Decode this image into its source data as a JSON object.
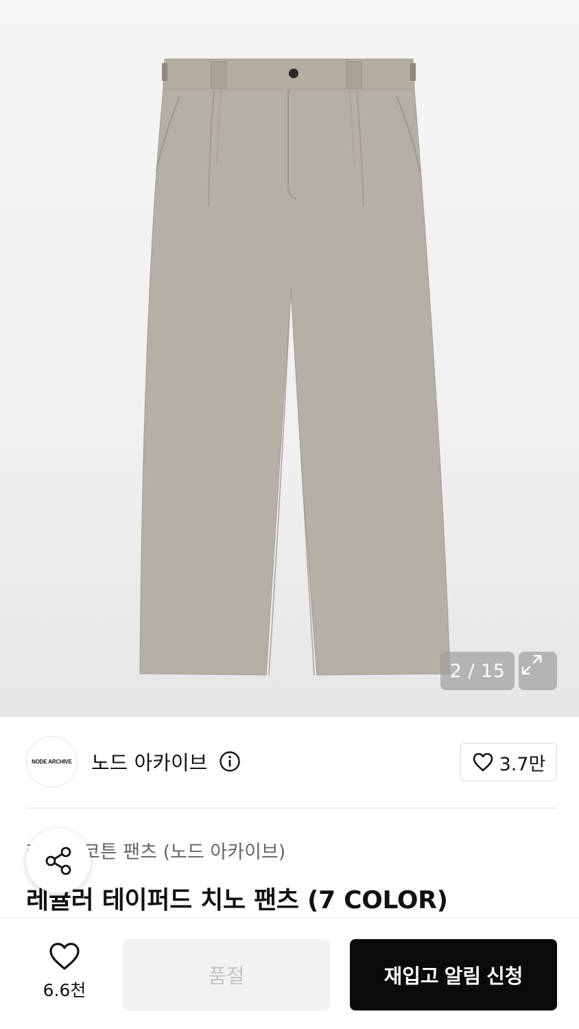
{
  "gallery": {
    "counter": "2 / 15",
    "product_image_alt": "beige chino pants"
  },
  "brand": {
    "logo_text": "NODE ARCHIVE",
    "name": "노드 아카이브",
    "like_count": "3.7만"
  },
  "product": {
    "category": "레귤러 코튼 팬츠 (노드 아카이브)",
    "title": "레귤러 테이퍼드 치노 팬츠 (7 COLOR)"
  },
  "bottom_bar": {
    "wish_count": "6.6천",
    "soldout_label": "품절",
    "restock_label": "재입고 알림 신청"
  },
  "colors": {
    "pants": "#b5b0a5",
    "accent_dark": "#0a0a0a",
    "muted": "#c4c4c4"
  },
  "icons": [
    "expand-icon",
    "info-icon",
    "heart-icon",
    "share-icon"
  ]
}
